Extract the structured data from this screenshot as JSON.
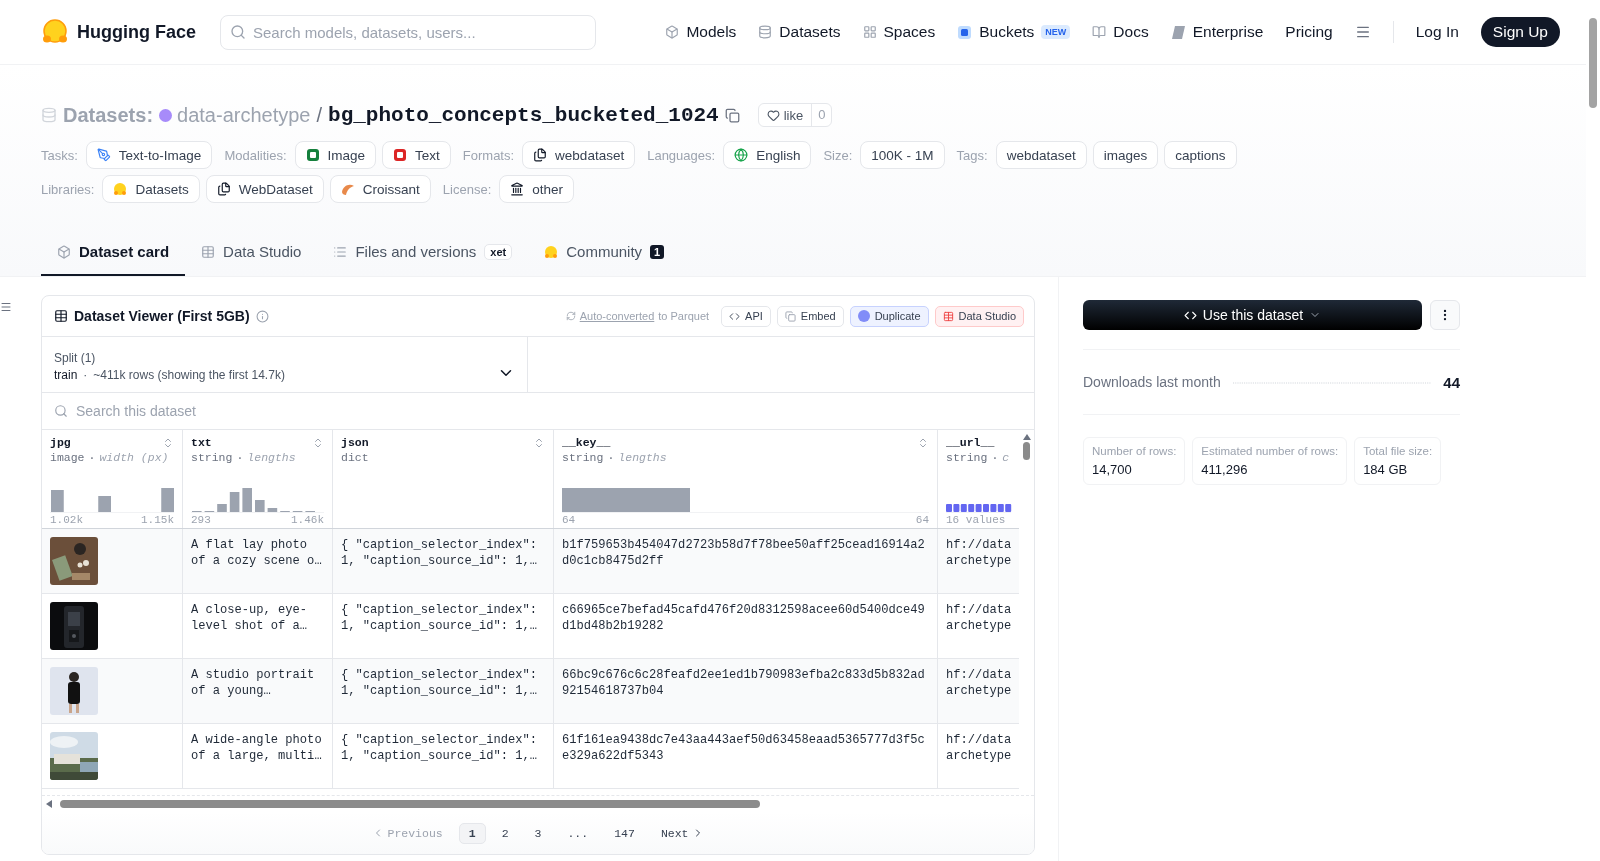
{
  "header": {
    "logo_text": "Hugging Face",
    "search": {
      "placeholder": "Search models, datasets, users..."
    },
    "nav": [
      {
        "label": "Models"
      },
      {
        "label": "Datasets"
      },
      {
        "label": "Spaces"
      },
      {
        "label": "Buckets",
        "badge": "NEW"
      },
      {
        "label": "Docs"
      },
      {
        "label": "Enterprise"
      },
      {
        "label": "Pricing"
      }
    ],
    "login": "Log In",
    "signup": "Sign Up"
  },
  "breadcrumb": {
    "section": "Datasets:",
    "owner": "data-archetype",
    "separator": "/",
    "name": "bg_photo_concepts_bucketed_1024",
    "like_label": "like",
    "like_count": "0"
  },
  "tag_rows": [
    [
      {
        "label": "Tasks:",
        "tags": [
          "Text-to-Image"
        ]
      },
      {
        "label": "Modalities:",
        "tags": [
          "Image",
          "Text"
        ]
      },
      {
        "label": "Formats:",
        "tags": [
          "webdataset"
        ]
      },
      {
        "label": "Languages:",
        "tags": [
          "English"
        ]
      },
      {
        "label": "Size:",
        "tags": [
          "100K - 1M"
        ]
      },
      {
        "label": "Tags:",
        "tags": [
          "webdataset",
          "images",
          "captions"
        ]
      }
    ],
    [
      {
        "label": "Libraries:",
        "tags": [
          "Datasets",
          "WebDataset",
          "Croissant"
        ]
      },
      {
        "label": "License:",
        "tags": [
          "other"
        ]
      }
    ]
  ],
  "tabs": [
    {
      "label": "Dataset card",
      "selected": true
    },
    {
      "label": "Data Studio",
      "selected": false
    },
    {
      "label": "Files and versions",
      "selected": false,
      "badge": "xet"
    },
    {
      "label": "Community",
      "selected": false,
      "count": "1"
    }
  ],
  "viewer": {
    "title": "Dataset Viewer (First 5GB)",
    "converted_link": "Auto-converted",
    "converted_text": "to Parquet",
    "actions": [
      {
        "label": "API",
        "kind": "plain"
      },
      {
        "label": "Embed",
        "kind": "plain"
      },
      {
        "label": "Duplicate",
        "kind": "accent"
      },
      {
        "label": "Data Studio",
        "kind": "danger"
      }
    ],
    "split": {
      "label": "Split (1)",
      "name": "train",
      "separator": "·",
      "info": "~411k rows (showing the first 14.7k)"
    },
    "search": {
      "placeholder": "Search this dataset"
    },
    "columns": [
      {
        "name": "jpg",
        "type": "image",
        "separator": "·",
        "stat": "width (px)",
        "min": "1.02k",
        "max": "1.15k",
        "sortable": true,
        "kind": "bars"
      },
      {
        "name": "txt",
        "type": "string",
        "separator": "·",
        "stat": "lengths",
        "min": "293",
        "max": "1.46k",
        "sortable": true,
        "kind": "bars"
      },
      {
        "name": "json",
        "type": "dict",
        "sortable": true,
        "kind": "none"
      },
      {
        "name": "__key__",
        "type": "string",
        "separator": "·",
        "stat": "lengths",
        "min": "64",
        "max": "64",
        "sortable": true,
        "kind": "single"
      },
      {
        "name": "__url__",
        "type": "string",
        "separator": "·",
        "stat": "c",
        "min": "16 values",
        "sortable": false,
        "kind": "categories"
      }
    ],
    "rows": [
      {
        "txt": "A flat lay photo of a cozy scene o…",
        "json": "{ \"caption_selector_index\": 1, \"caption_source_id\": 1,…",
        "key": "b1f759653b454047d2723b58d7f78bee50aff25cead16914a2d0c1cb8475d2ff",
        "url": "hf://data archetype"
      },
      {
        "txt": "A close-up, eye-level shot of a…",
        "json": "{ \"caption_selector_index\": 1, \"caption_source_id\": 1,…",
        "key": "c66965ce7befad45cafd476f20d8312598acee60d5400dce49d1bd48b2b19282",
        "url": "hf://data archetype"
      },
      {
        "txt": "A studio portrait of a young…",
        "json": "{ \"caption_selector_index\": 1, \"caption_source_id\": 1,…",
        "key": "66bc9c676c6c28feafd2ee1ed1b790983efba2c833d5b832ad92154618737b04",
        "url": "hf://data archetype"
      },
      {
        "txt": "A wide-angle photo of a large, multi…",
        "json": "{ \"caption_selector_index\": 1, \"caption_source_id\": 1,…",
        "key": "61f161ea9438dc7e43aa443aef50d63458eaad5365777d3f5ce329a622df5343",
        "url": "hf://data archetype"
      }
    ],
    "pagination": [
      {
        "label": "Previous",
        "kind": "prev",
        "selected": false
      },
      {
        "label": "1",
        "kind": "page",
        "selected": true
      },
      {
        "label": "2",
        "kind": "page",
        "selected": false
      },
      {
        "label": "3",
        "kind": "page",
        "selected": false
      },
      {
        "label": "...",
        "kind": "gap",
        "selected": false
      },
      {
        "label": "147",
        "kind": "page",
        "selected": false
      },
      {
        "label": "Next",
        "kind": "next",
        "selected": false
      }
    ]
  },
  "sidebar": {
    "use_button": "Use this dataset",
    "downloads_label": "Downloads last month",
    "downloads_value": "44",
    "stats": [
      {
        "label": "Number of rows:",
        "value": "14,700"
      },
      {
        "label": "Estimated number of rows:",
        "value": "411,296"
      },
      {
        "label": "Total file size:",
        "value": "184 GB"
      }
    ]
  }
}
